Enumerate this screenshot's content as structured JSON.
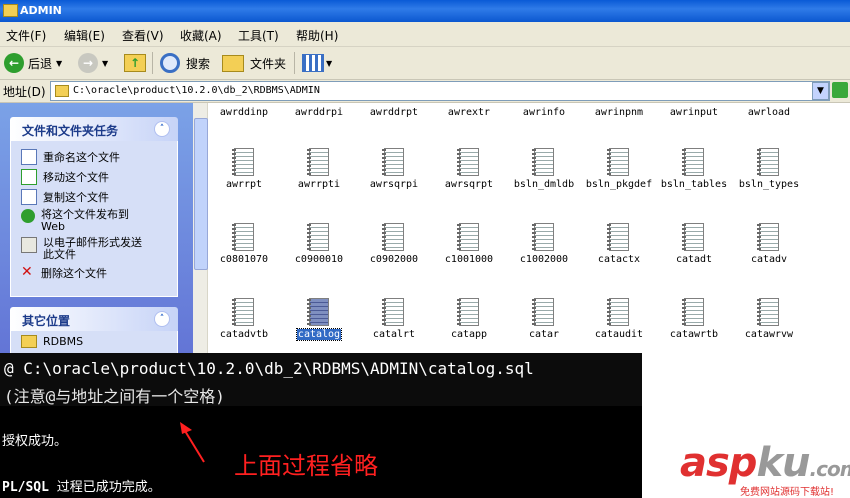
{
  "window": {
    "title": "ADMIN"
  },
  "menu": [
    "文件(F)",
    "编辑(E)",
    "查看(V)",
    "收藏(A)",
    "工具(T)",
    "帮助(H)"
  ],
  "toolbar": {
    "back_label": "后退",
    "search_label": "搜索",
    "folders_label": "文件夹"
  },
  "address": {
    "label": "地址(D)",
    "path": "C:\\oracle\\product\\10.2.0\\db_2\\RDBMS\\ADMIN"
  },
  "left": {
    "tasks_title": "文件和文件夹任务",
    "tasks": [
      {
        "label": "重命名这个文件",
        "icon": "rename-icon"
      },
      {
        "label": "移动这个文件",
        "icon": "move-icon"
      },
      {
        "label": "复制这个文件",
        "icon": "copy-icon"
      },
      {
        "label": "将这个文件发布到\nWeb",
        "icon": "publish-web-icon"
      },
      {
        "label": "以电子邮件形式发送\n此文件",
        "icon": "email-icon"
      },
      {
        "label": "删除这个文件",
        "icon": "delete-icon"
      }
    ],
    "places_title": "其它位置",
    "places": [
      {
        "label": "RDBMS",
        "icon": "folder-icon"
      }
    ]
  },
  "files": {
    "top_row": [
      "awrddinp",
      "awrddrpi",
      "awrddrpt",
      "awrextr",
      "awrinfo",
      "awrinpnm",
      "awrinput",
      "awrload"
    ],
    "rows": [
      [
        "awrrpt",
        "awrrpti",
        "awrsqrpi",
        "awrsqrpt",
        "bsln_dmldb",
        "bsln_pkgdef",
        "bsln_tables",
        "bsln_types"
      ],
      [
        "c0801070",
        "c0900010",
        "c0902000",
        "c1001000",
        "c1002000",
        "catactx",
        "catadt",
        "catadv"
      ],
      [
        "catadvtb",
        "catalog",
        "catalrt",
        "catapp",
        "catar",
        "cataudit",
        "catawrtb",
        "catawrvw"
      ]
    ],
    "selected": "catalog"
  },
  "console": {
    "line1": "@ C:\\oracle\\product\\10.2.0\\db_2\\RDBMS\\ADMIN\\catalog.sql",
    "line2": "(注意@与地址之间有一个空格)",
    "out1": "授权成功。",
    "out2_prefix": "PL/SQL",
    "out2_rest": " 过程已成功完成。"
  },
  "annotation": "上面过程省略",
  "watermark": {
    "main_asp": "asp",
    "main_ku": "ku",
    "main_com": ".com",
    "sub": "免费网站源码下载站!"
  },
  "colors": {
    "accent": "#0a5ad6",
    "annotation": "#ff2020",
    "watermark_red": "#e03030",
    "selection": "#316ac5"
  }
}
